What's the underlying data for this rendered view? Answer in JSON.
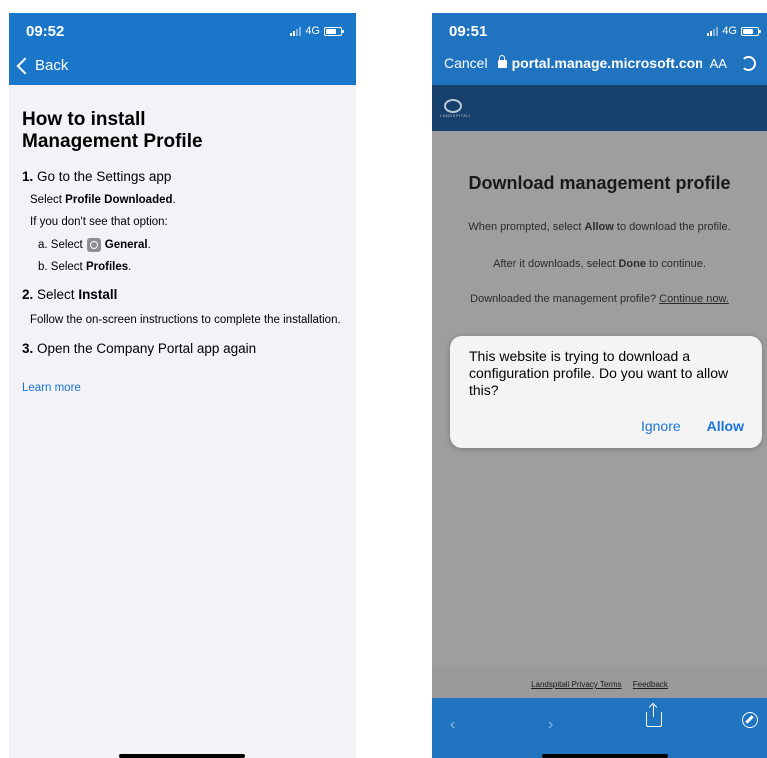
{
  "left": {
    "status": {
      "time": "09:52",
      "network": "4G"
    },
    "nav": {
      "back_label": "Back"
    },
    "title_line1": "How to install",
    "title_line2": "Management Profile",
    "step1": {
      "num": "1.",
      "text": "Go to the Settings app"
    },
    "step1_sub": {
      "pre": "Select ",
      "bold": "Profile Downloaded",
      "post": "."
    },
    "step1_note": "If you don't see that option:",
    "step1_a": {
      "pre": "a. Select ",
      "bold": "General",
      "post": "."
    },
    "step1_b": {
      "pre": "b. Select ",
      "bold": "Profiles",
      "post": "."
    },
    "step2": {
      "num": "2.",
      "pre": "Select ",
      "bold": "Install"
    },
    "step2_sub": "Follow the on-screen instructions to complete the installation.",
    "step3": {
      "num": "3.",
      "text": "Open the Company Portal app again"
    },
    "learn_more": "Learn more"
  },
  "right": {
    "status": {
      "time": "09:51",
      "network": "4G"
    },
    "nav": {
      "cancel": "Cancel",
      "url": "portal.manage.microsoft.com",
      "text_size": "AA"
    },
    "brand_text": "LANDSPITALI",
    "heading": "Download management profile",
    "line1": {
      "pre": "When prompted, select ",
      "bold": "Allow",
      "post": " to download the profile."
    },
    "line2": {
      "pre": "After it downloads, select ",
      "bold": "Done",
      "post": " to continue."
    },
    "line3": {
      "pre": "Downloaded the management profile? ",
      "link": "Continue now."
    },
    "dialog": {
      "message": "This website is trying to download a configuration profile. Do you want to allow this?",
      "ignore": "Ignore",
      "allow": "Allow"
    },
    "footer": {
      "privacy": "Landspitali Privacy Terms",
      "feedback": "Feedback"
    },
    "toolbar": {
      "back": "‹",
      "forward": "›"
    }
  }
}
